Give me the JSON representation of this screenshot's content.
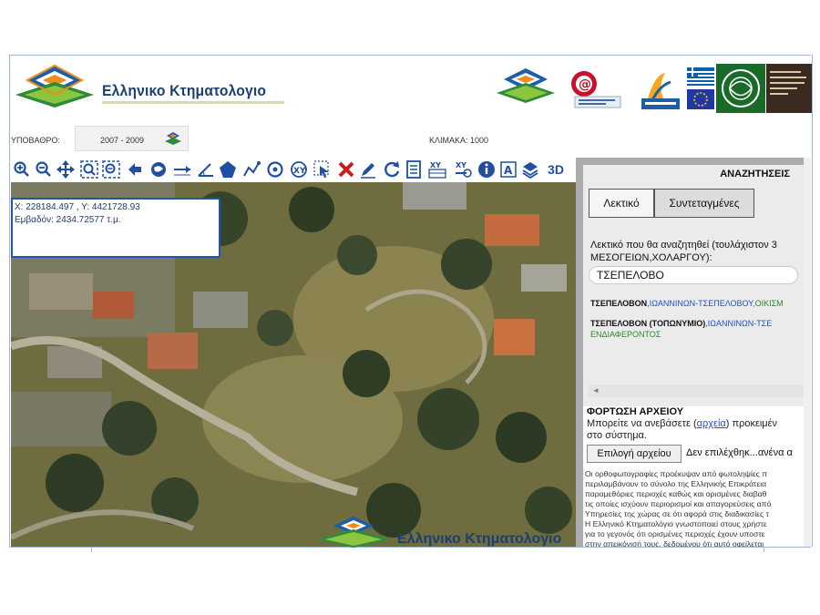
{
  "header": {
    "brand": "Ελληνικο Κτηματολογιο"
  },
  "underlay": {
    "label": "ΥΠΟΒΑΘΡΟ:",
    "value": "2007 - 2009"
  },
  "scale": {
    "label": "ΚΛΙΜΑΚΑ: 1000"
  },
  "toolbar": {
    "icons": [
      "zoom-in-icon",
      "zoom-out-icon",
      "pan-icon",
      "zoom-box-in-icon",
      "zoom-box-out-icon",
      "previous-view-icon",
      "full-extent-icon",
      "measure-line-icon",
      "measure-angle-icon",
      "measure-area-icon",
      "polyline-icon",
      "circle-icon",
      "xy-point-icon",
      "select-icon",
      "clear-icon",
      "edit-icon",
      "refresh-icon",
      "document-icon",
      "xy-table-icon",
      "xy-goto-icon",
      "info-icon",
      "text-label-icon",
      "layers-icon"
    ],
    "label_3d": "3D"
  },
  "coords": {
    "line1": "X: 228184.497 , Y: 4421728.93",
    "line2": "Εμβαδόν: 2434.72577 τ.μ."
  },
  "map": {
    "watermark": "Ελληνικο Κτηματολογιο"
  },
  "search": {
    "title": "ΑΝΑΖΗΤΗΣΕΙΣ",
    "tab_text": "Λεκτικό",
    "tab_coords": "Συντεταγμένες",
    "hint": "Λεκτικό που θα αναζητηθεί (τουλάχιστον 3 ΜΕΣΟΓΕΙΩΝ,ΧΟΛΑΡΓΟΥ):",
    "query": "ΤΣΕΠΕΛΟΒΟ",
    "results": [
      {
        "name": "ΤΣΕΠΕΛΟΒΟΝ",
        "sep": ",",
        "region": "ΙΩΑΝΝΙΝΩΝ-ΤΣΕΠΕΛΟΒΟΥ",
        "kind": ",ΟΙΚΙΣΜ",
        "kind2": ""
      },
      {
        "name": "ΤΣΕΠΕΛΟΒΟΝ (ΤΟΠΩΝΥΜΙΟ)",
        "sep": ",",
        "region": "ΙΩΑΝΝΙΝΩΝ-ΤΣΕ",
        "kind": "",
        "kind2": "ΕΝΔΙΑΦΕΡΟΝΤΟΣ"
      }
    ],
    "scroll_left": "◄"
  },
  "upload": {
    "title": "ΦΟΡΤΩΣΗ ΑΡΧΕΙΟΥ",
    "desc_before": "Μπορείτε να ανεβάσετε (",
    "desc_link": "αρχεία",
    "desc_after": ") προκειμέν",
    "desc_line2": "στο σύστημα.",
    "button": "Επιλογή αρχείου",
    "no_file": "Δεν επιλέχθηκ...ανένα α"
  },
  "disclaimer": [
    "Οι ορθοφωτογραφίες προέκυψαν από φωτοληψίες π",
    "περιλαμβάνουν το σύνολο της Ελληνικής Επικράτεια",
    "παραμεθόριες περιοχές καθώς και ορισμένες διαβαθ",
    "τις οποίες ισχύουν περιορισμοί και απαγορεύσεις από",
    "Υπηρεσίες της χώρας σε ότι αφορά στις διαδικασίες τ",
    "Η Ελληνικό Κτηματολόγιο γνωστοποιεί στους χρήστε",
    "για το γεγονός ότι ορισμένες περιοχές έχουν υποστε",
    "στην απεικόνισή τους, δεδομένου ότι αυτό οφείλεται"
  ]
}
